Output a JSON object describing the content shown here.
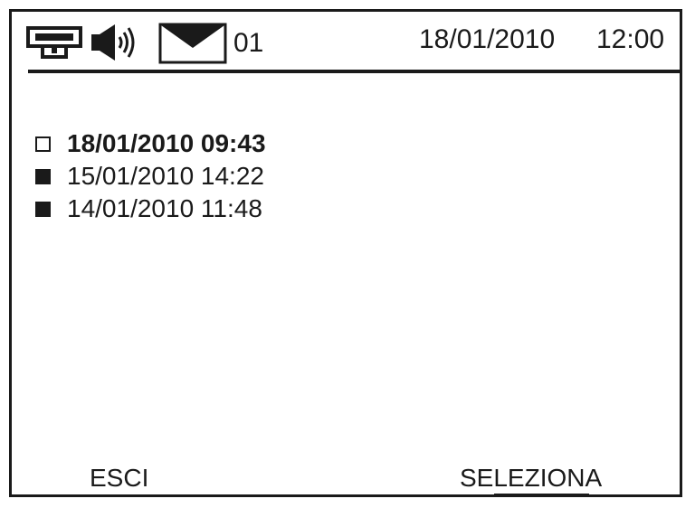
{
  "status_bar": {
    "icons": [
      "network-icon",
      "speaker-icon",
      "envelope-icon"
    ],
    "message_count": "01",
    "date": "18/01/2010",
    "time": "12:00"
  },
  "messages": [
    {
      "label": "18/01/2010 09:43",
      "state": "unread",
      "selected": true
    },
    {
      "label": "15/01/2010 14:22",
      "state": "read",
      "selected": false
    },
    {
      "label": "14/01/2010 11:48",
      "state": "read",
      "selected": false
    }
  ],
  "softkeys": {
    "left": "ESCI",
    "right": "SELEZIONA"
  },
  "colors": {
    "foreground": "#1a1a1a",
    "background": "#ffffff"
  }
}
